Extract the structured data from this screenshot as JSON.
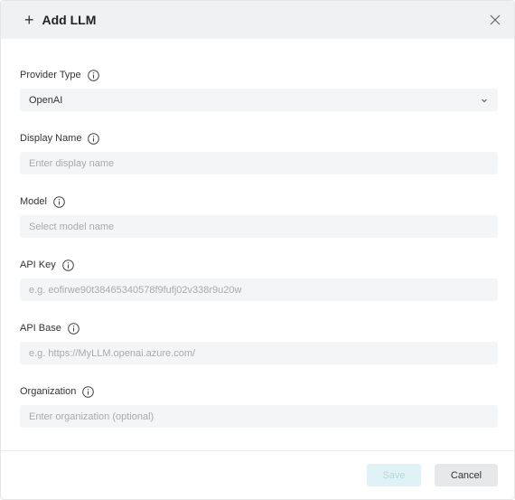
{
  "header": {
    "title": "Add LLM"
  },
  "fields": [
    {
      "label": "Provider Type",
      "value": "OpenAI"
    },
    {
      "label": "Display Name",
      "placeholder": "Enter display name"
    },
    {
      "label": "Model",
      "placeholder": "Select model name"
    },
    {
      "label": "API Key",
      "placeholder": "e.g. eofirwe90t38465340578f9fufj02v338r9u20w"
    },
    {
      "label": "API Base",
      "placeholder": "e.g. https://MyLLM.openai.azure.com/"
    },
    {
      "label": "Organization",
      "placeholder": "Enter organization (optional)"
    }
  ],
  "footer": {
    "save_label": "Save",
    "cancel_label": "Cancel"
  },
  "icons": {
    "header": "plus-icon",
    "close": "close-icon",
    "info": "info-icon",
    "select": "chevron-down-icon"
  },
  "colors": {
    "header_bg": "#f0f1f3",
    "input_bg": "#f4f5f7",
    "save_disabled_bg": "#dff3f6"
  }
}
